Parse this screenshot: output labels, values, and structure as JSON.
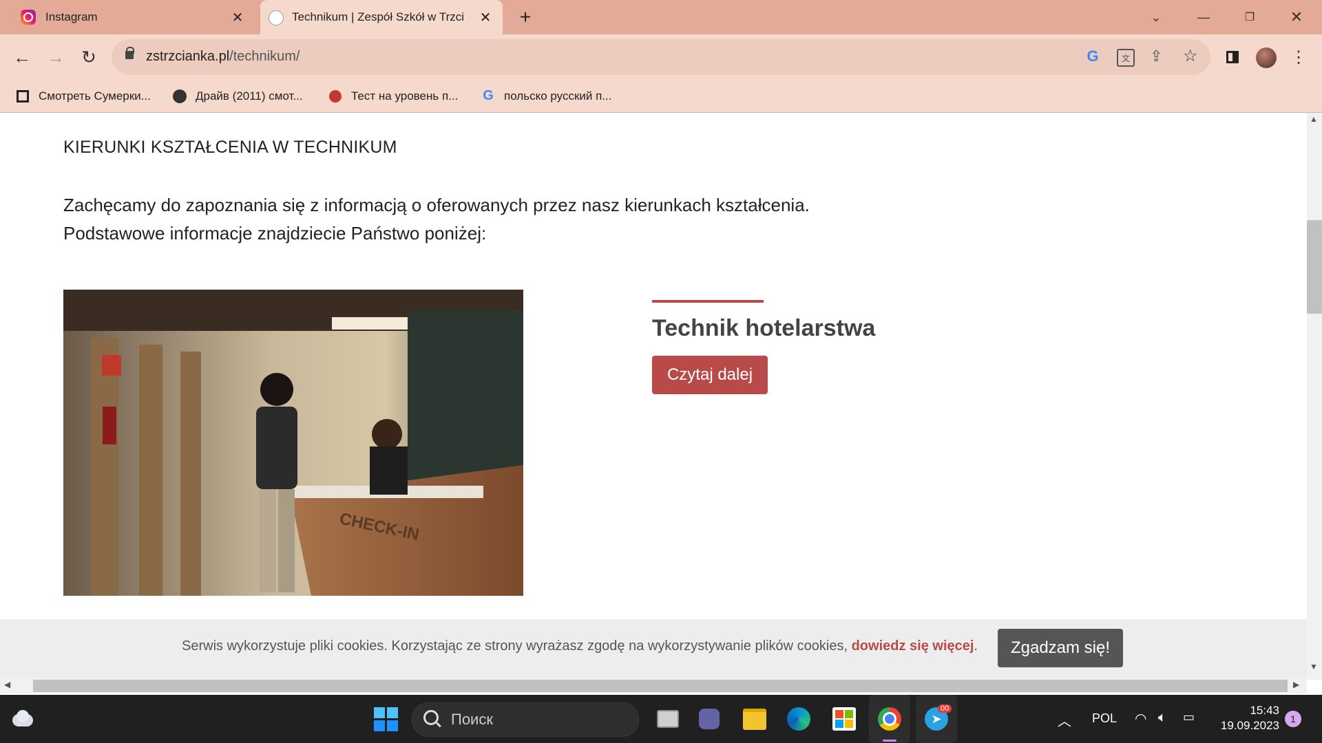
{
  "browser": {
    "tabs": [
      {
        "title": "Instagram",
        "icon": "instagram-icon"
      },
      {
        "title": "Technikum | Zespół Szkół w Trzci",
        "icon": "school-crest-icon"
      }
    ],
    "url_domain": "zstrzcianka.pl",
    "url_path": "/technikum/",
    "bookmarks": [
      {
        "label": "Смотреть Сумерки...",
        "icon": "film-icon"
      },
      {
        "label": "Драйв (2011) смот...",
        "icon": "avatar-icon"
      },
      {
        "label": "Тест на уровень п...",
        "icon": "quiz-icon"
      },
      {
        "label": "польско русский п...",
        "icon": "google-icon"
      }
    ]
  },
  "page": {
    "heading": "KIERUNKI KSZTAŁCENIA W TECHNIKUM",
    "intro_line1": "Zachęcamy do zapoznania się z informacją o oferowanych przez nasz kierunkach kształcenia.",
    "intro_line2": "Podstawowe informacje znajdziecie Państwo poniżej:",
    "card": {
      "title": "Technik hotelarstwa",
      "button": "Czytaj dalej",
      "photo_caption_visible": "CHECK-IN",
      "accent_color": "#b84a4a"
    }
  },
  "cookie_bar": {
    "text": "Serwis wykorzystuje pliki cookies. Korzystając ze strony wyrażasz zgodę na wykorzystywanie plików cookies, ",
    "link": "dowiedz się więcej",
    "suffix": ".",
    "button": "Zgadzam się!"
  },
  "taskbar": {
    "search_placeholder": "Поиск",
    "language": "POL",
    "time": "15:43",
    "date": "19.09.2023",
    "notification_count": "1",
    "telegram_badge": "00"
  }
}
